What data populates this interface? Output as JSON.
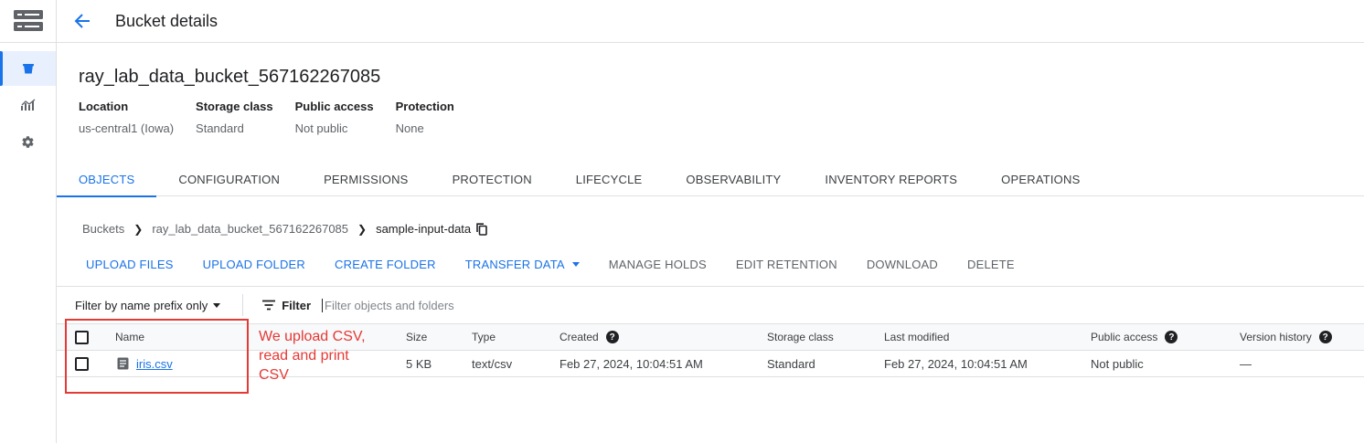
{
  "header": {
    "title": "Bucket details"
  },
  "bucket": {
    "name": "ray_lab_data_bucket_567162267085",
    "properties": [
      {
        "label": "Location",
        "value": "us-central1 (Iowa)"
      },
      {
        "label": "Storage class",
        "value": "Standard"
      },
      {
        "label": "Public access",
        "value": "Not public"
      },
      {
        "label": "Protection",
        "value": "None"
      }
    ]
  },
  "tabs": [
    "OBJECTS",
    "CONFIGURATION",
    "PERMISSIONS",
    "PROTECTION",
    "LIFECYCLE",
    "OBSERVABILITY",
    "INVENTORY REPORTS",
    "OPERATIONS"
  ],
  "breadcrumb": [
    "Buckets",
    "ray_lab_data_bucket_567162267085",
    "sample-input-data"
  ],
  "toolbar": {
    "upload_files": "UPLOAD FILES",
    "upload_folder": "UPLOAD FOLDER",
    "create_folder": "CREATE FOLDER",
    "transfer_data": "TRANSFER DATA",
    "manage_holds": "MANAGE HOLDS",
    "edit_retention": "EDIT RETENTION",
    "download": "DOWNLOAD",
    "delete": "DELETE"
  },
  "filter": {
    "mode": "Filter by name prefix only",
    "label": "Filter",
    "placeholder": "Filter objects and folders"
  },
  "table": {
    "columns": {
      "name": "Name",
      "size": "Size",
      "type": "Type",
      "created": "Created",
      "storage_class": "Storage class",
      "last_modified": "Last modified",
      "public_access": "Public access",
      "version_history": "Version history"
    },
    "rows": [
      {
        "name": "iris.csv",
        "size": "5 KB",
        "type": "text/csv",
        "created": "Feb 27, 2024, 10:04:51 AM",
        "storage_class": "Standard",
        "last_modified": "Feb 27, 2024, 10:04:51 AM",
        "public_access": "Not public",
        "version_history": "—"
      }
    ]
  },
  "annotation": {
    "text": "We upload CSV, read and print CSV",
    "color": "#e53935"
  },
  "colors": {
    "accent": "#1a73e8",
    "annotation": "#e53935"
  }
}
